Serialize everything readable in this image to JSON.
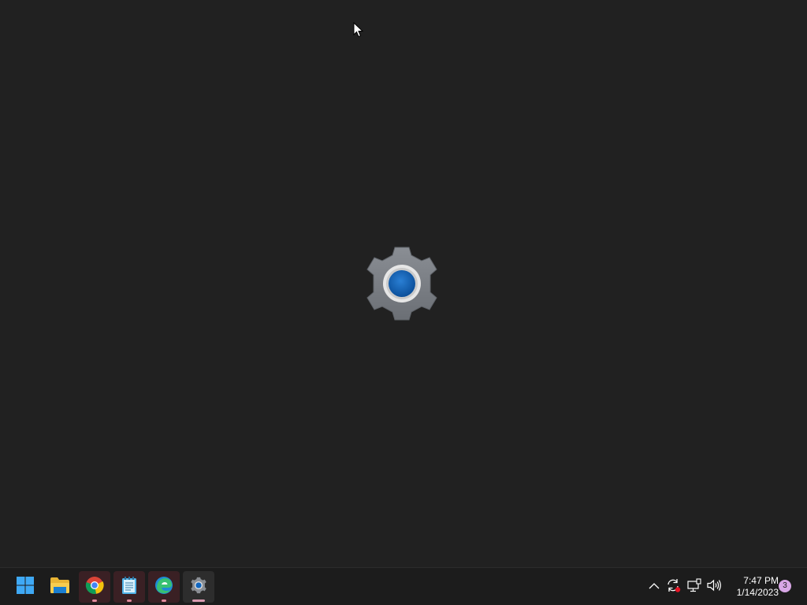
{
  "splash": {
    "app_icon": "settings-gear-icon"
  },
  "taskbar": {
    "apps": [
      {
        "name": "start",
        "icon": "windows-start-icon",
        "state": "none"
      },
      {
        "name": "file-explorer",
        "icon": "folder-icon",
        "state": "none"
      },
      {
        "name": "chrome",
        "icon": "chrome-icon",
        "state": "open"
      },
      {
        "name": "notepad",
        "icon": "notepad-icon",
        "state": "open"
      },
      {
        "name": "edge",
        "icon": "edge-icon",
        "state": "open"
      },
      {
        "name": "settings",
        "icon": "settings-gear-icon",
        "state": "active"
      }
    ],
    "tray": {
      "icons": [
        "chevron-up-icon",
        "sync-icon",
        "network-icon",
        "volume-icon"
      ],
      "time": "7:47 PM",
      "date": "1/14/2023",
      "notification_count": "3"
    }
  },
  "colors": {
    "background": "#202020",
    "taskbar": "#1c1c1c",
    "gear": "#7d8187",
    "accent": "#0f5fb0",
    "badge": "#d8a7e6"
  }
}
